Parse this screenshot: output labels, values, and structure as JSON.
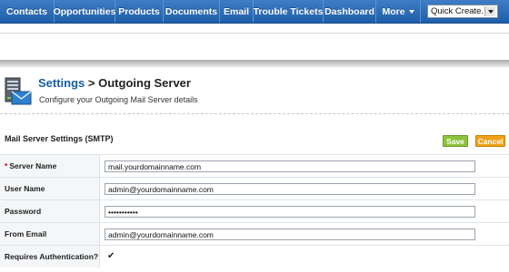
{
  "nav": {
    "items": [
      "Contacts",
      "Opportunities",
      "Products",
      "Documents",
      "Email",
      "Trouble Tickets",
      "Dashboard",
      "More"
    ],
    "quick_create": "Quick Create..."
  },
  "header": {
    "breadcrumb_root": "Settings",
    "separator": " > ",
    "title": "Outgoing Server",
    "description": "Configure your Outgoing Mail Server details",
    "icon": "mail-server-icon"
  },
  "section": {
    "title": "Mail Server Settings (SMTP)",
    "save_label": "Save",
    "cancel_label": "Cancel"
  },
  "form": {
    "fields": [
      {
        "label": "Server Name",
        "required_mark": "*",
        "value": "mail.yourdomainname.com"
      },
      {
        "label": "User Name",
        "value": "admin@yourdomainname.com"
      },
      {
        "label": "Password",
        "value": "•••••••••••"
      },
      {
        "label": "From Email",
        "value": "admin@yourdomainname.com"
      },
      {
        "label": "Requires Authentication?",
        "checked_glyph": "✔"
      }
    ]
  },
  "colors": {
    "nav_bg": "#2a6bb8",
    "link": "#1a5e9e",
    "save": "#8dc23c",
    "cancel": "#f0a118",
    "required": "#cc0000"
  }
}
